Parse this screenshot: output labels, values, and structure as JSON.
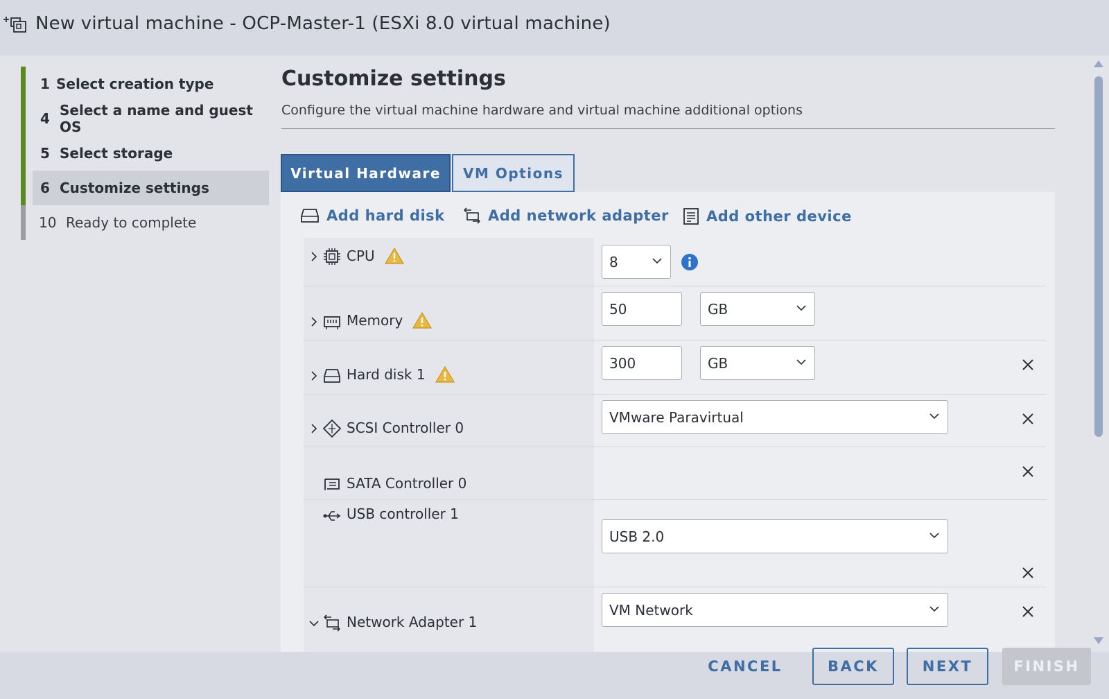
{
  "window": {
    "title": "New virtual machine - OCP-Master-1 (ESXi 8.0 virtual machine)"
  },
  "steps": [
    {
      "num": "1",
      "label": "Select creation type",
      "state": "done"
    },
    {
      "num": "4",
      "label": "Select a name and guest OS",
      "state": "done"
    },
    {
      "num": "5",
      "label": "Select storage",
      "state": "done"
    },
    {
      "num": "6",
      "label": "Customize settings",
      "state": "active"
    },
    {
      "num": "10",
      "label": "Ready to complete",
      "state": "pending"
    }
  ],
  "page": {
    "title": "Customize settings",
    "subtitle": "Configure the virtual machine hardware and virtual machine additional options"
  },
  "tabs": {
    "virtual_hardware": "Virtual Hardware",
    "vm_options": "VM Options"
  },
  "actions": {
    "add_hard_disk": "Add hard disk",
    "add_network_adapter": "Add network adapter",
    "add_other_device": "Add other device"
  },
  "devices": {
    "cpu": {
      "label": "CPU",
      "value": "8"
    },
    "memory": {
      "label": "Memory",
      "value": "50",
      "unit": "GB"
    },
    "hard_disk": {
      "label": "Hard disk 1",
      "value": "300",
      "unit": "GB"
    },
    "scsi": {
      "label": "SCSI Controller 0",
      "value": "VMware Paravirtual"
    },
    "sata": {
      "label": "SATA Controller 0"
    },
    "usb": {
      "label": "USB controller 1",
      "value": "USB 2.0"
    },
    "network": {
      "label": "Network Adapter 1",
      "value": "VM Network"
    }
  },
  "footer": {
    "cancel": "CANCEL",
    "back": "BACK",
    "next": "NEXT",
    "finish": "FINISH"
  },
  "colors": {
    "accent": "#3e6ea4",
    "done_bar": "#5d8a1e",
    "warning": "#e8b940",
    "info": "#2f73c9"
  }
}
